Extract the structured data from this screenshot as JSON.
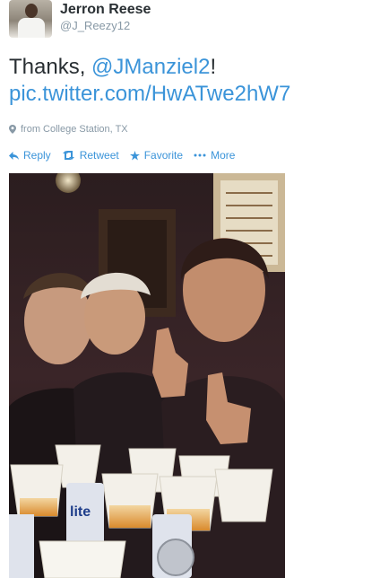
{
  "user": {
    "fullname": "Jerron Reese",
    "screen_name": "@J_Reezy12"
  },
  "tweet": {
    "text_prefix": "Thanks, ",
    "mention": "@JManziel2",
    "text_suffix": "!",
    "link": "pic.twitter.com/HwATwe2hW7",
    "location": "from College Station, TX"
  },
  "actions": {
    "reply": "Reply",
    "retweet": "Retweet",
    "favorite": "Favorite",
    "more": "More"
  },
  "photo_text": {
    "cup_brand": "lite"
  },
  "colors": {
    "link": "#3b94d9",
    "muted": "#8899a6",
    "text": "#292f33"
  }
}
